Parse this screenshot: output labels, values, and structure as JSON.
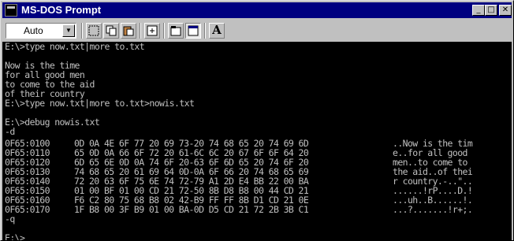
{
  "window": {
    "title": "MS-DOS Prompt"
  },
  "caption_buttons": {
    "minimize": "_",
    "maximize": "□",
    "close": "✕"
  },
  "toolbar": {
    "font_size_value": "Auto",
    "font_button_label": "A",
    "buttons": [
      "mark",
      "copy",
      "paste",
      "full-screen",
      "properties",
      "background",
      "font"
    ]
  },
  "console": {
    "lines_before": [
      "E:\\>type now.txt|more to.txt",
      "",
      "Now is the time",
      "for all good men",
      "to come to the aid",
      "of their country",
      "E:\\>type now.txt|more to.txt>nowis.txt",
      "",
      "E:\\>debug nowis.txt",
      "-d"
    ],
    "dump": [
      {
        "addr": "0F65:0100",
        "hex": "0D 0A 4E 6F 77 20 69 73-20 74 68 65 20 74 69 6D",
        "ascii": "..Now is the tim"
      },
      {
        "addr": "0F65:0110",
        "hex": "65 0D 0A 66 6F 72 20 61-6C 6C 20 67 6F 6F 64 20",
        "ascii": "e..for all good "
      },
      {
        "addr": "0F65:0120",
        "hex": "6D 65 6E 0D 0A 74 6F 20-63 6F 6D 65 20 74 6F 20",
        "ascii": "men..to come to "
      },
      {
        "addr": "0F65:0130",
        "hex": "74 68 65 20 61 69 64 0D-0A 6F 66 20 74 68 65 69",
        "ascii": "the aid..of thei"
      },
      {
        "addr": "0F65:0140",
        "hex": "72 20 63 6F 75 6E 74 72-79 A1 2D E4 BB 22 00 BA",
        "ascii": "r country.-..\".."
      },
      {
        "addr": "0F65:0150",
        "hex": "01 00 BF 01 00 CD 21 72-50 8B D8 B8 00 44 CD 21",
        "ascii": "......!rP....D.!"
      },
      {
        "addr": "0F65:0160",
        "hex": "F6 C2 80 75 68 B8 02 42-B9 FF FF 8B D1 CD 21 0E",
        "ascii": "...uh..B......!."
      },
      {
        "addr": "0F65:0170",
        "hex": "1F B8 00 3F B9 01 00 BA-0D D5 CD 21 72 2B 3B C1",
        "ascii": "...?.......!r+;."
      }
    ],
    "lines_after": [
      "-q",
      "",
      "E:\\>"
    ]
  }
}
